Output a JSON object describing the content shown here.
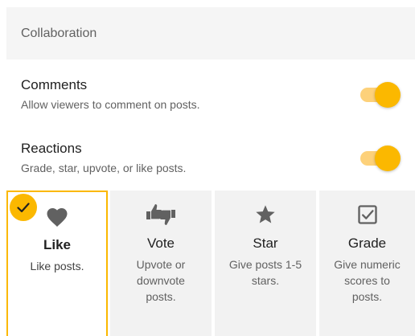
{
  "section": {
    "title": "Collaboration"
  },
  "settings": [
    {
      "title": "Comments",
      "description": "Allow viewers to comment on posts.",
      "enabled": true
    },
    {
      "title": "Reactions",
      "description": "Grade, star, upvote, or like posts.",
      "enabled": true
    }
  ],
  "reaction_options": [
    {
      "label": "Like",
      "description": "Like posts.",
      "icon": "heart-icon",
      "selected": true
    },
    {
      "label": "Vote",
      "description": "Upvote or downvote posts.",
      "icon": "thumbs-up-down-icon",
      "selected": false
    },
    {
      "label": "Star",
      "description": "Give posts 1-5 stars.",
      "icon": "star-icon",
      "selected": false
    },
    {
      "label": "Grade",
      "description": "Give numeric scores to posts.",
      "icon": "checkbox-icon",
      "selected": false
    }
  ],
  "colors": {
    "accent": "#fbb800",
    "accent_track": "#fdd17a",
    "icon": "#616161",
    "card_bg": "#f2f2f2",
    "header_bg": "#f5f5f5"
  }
}
